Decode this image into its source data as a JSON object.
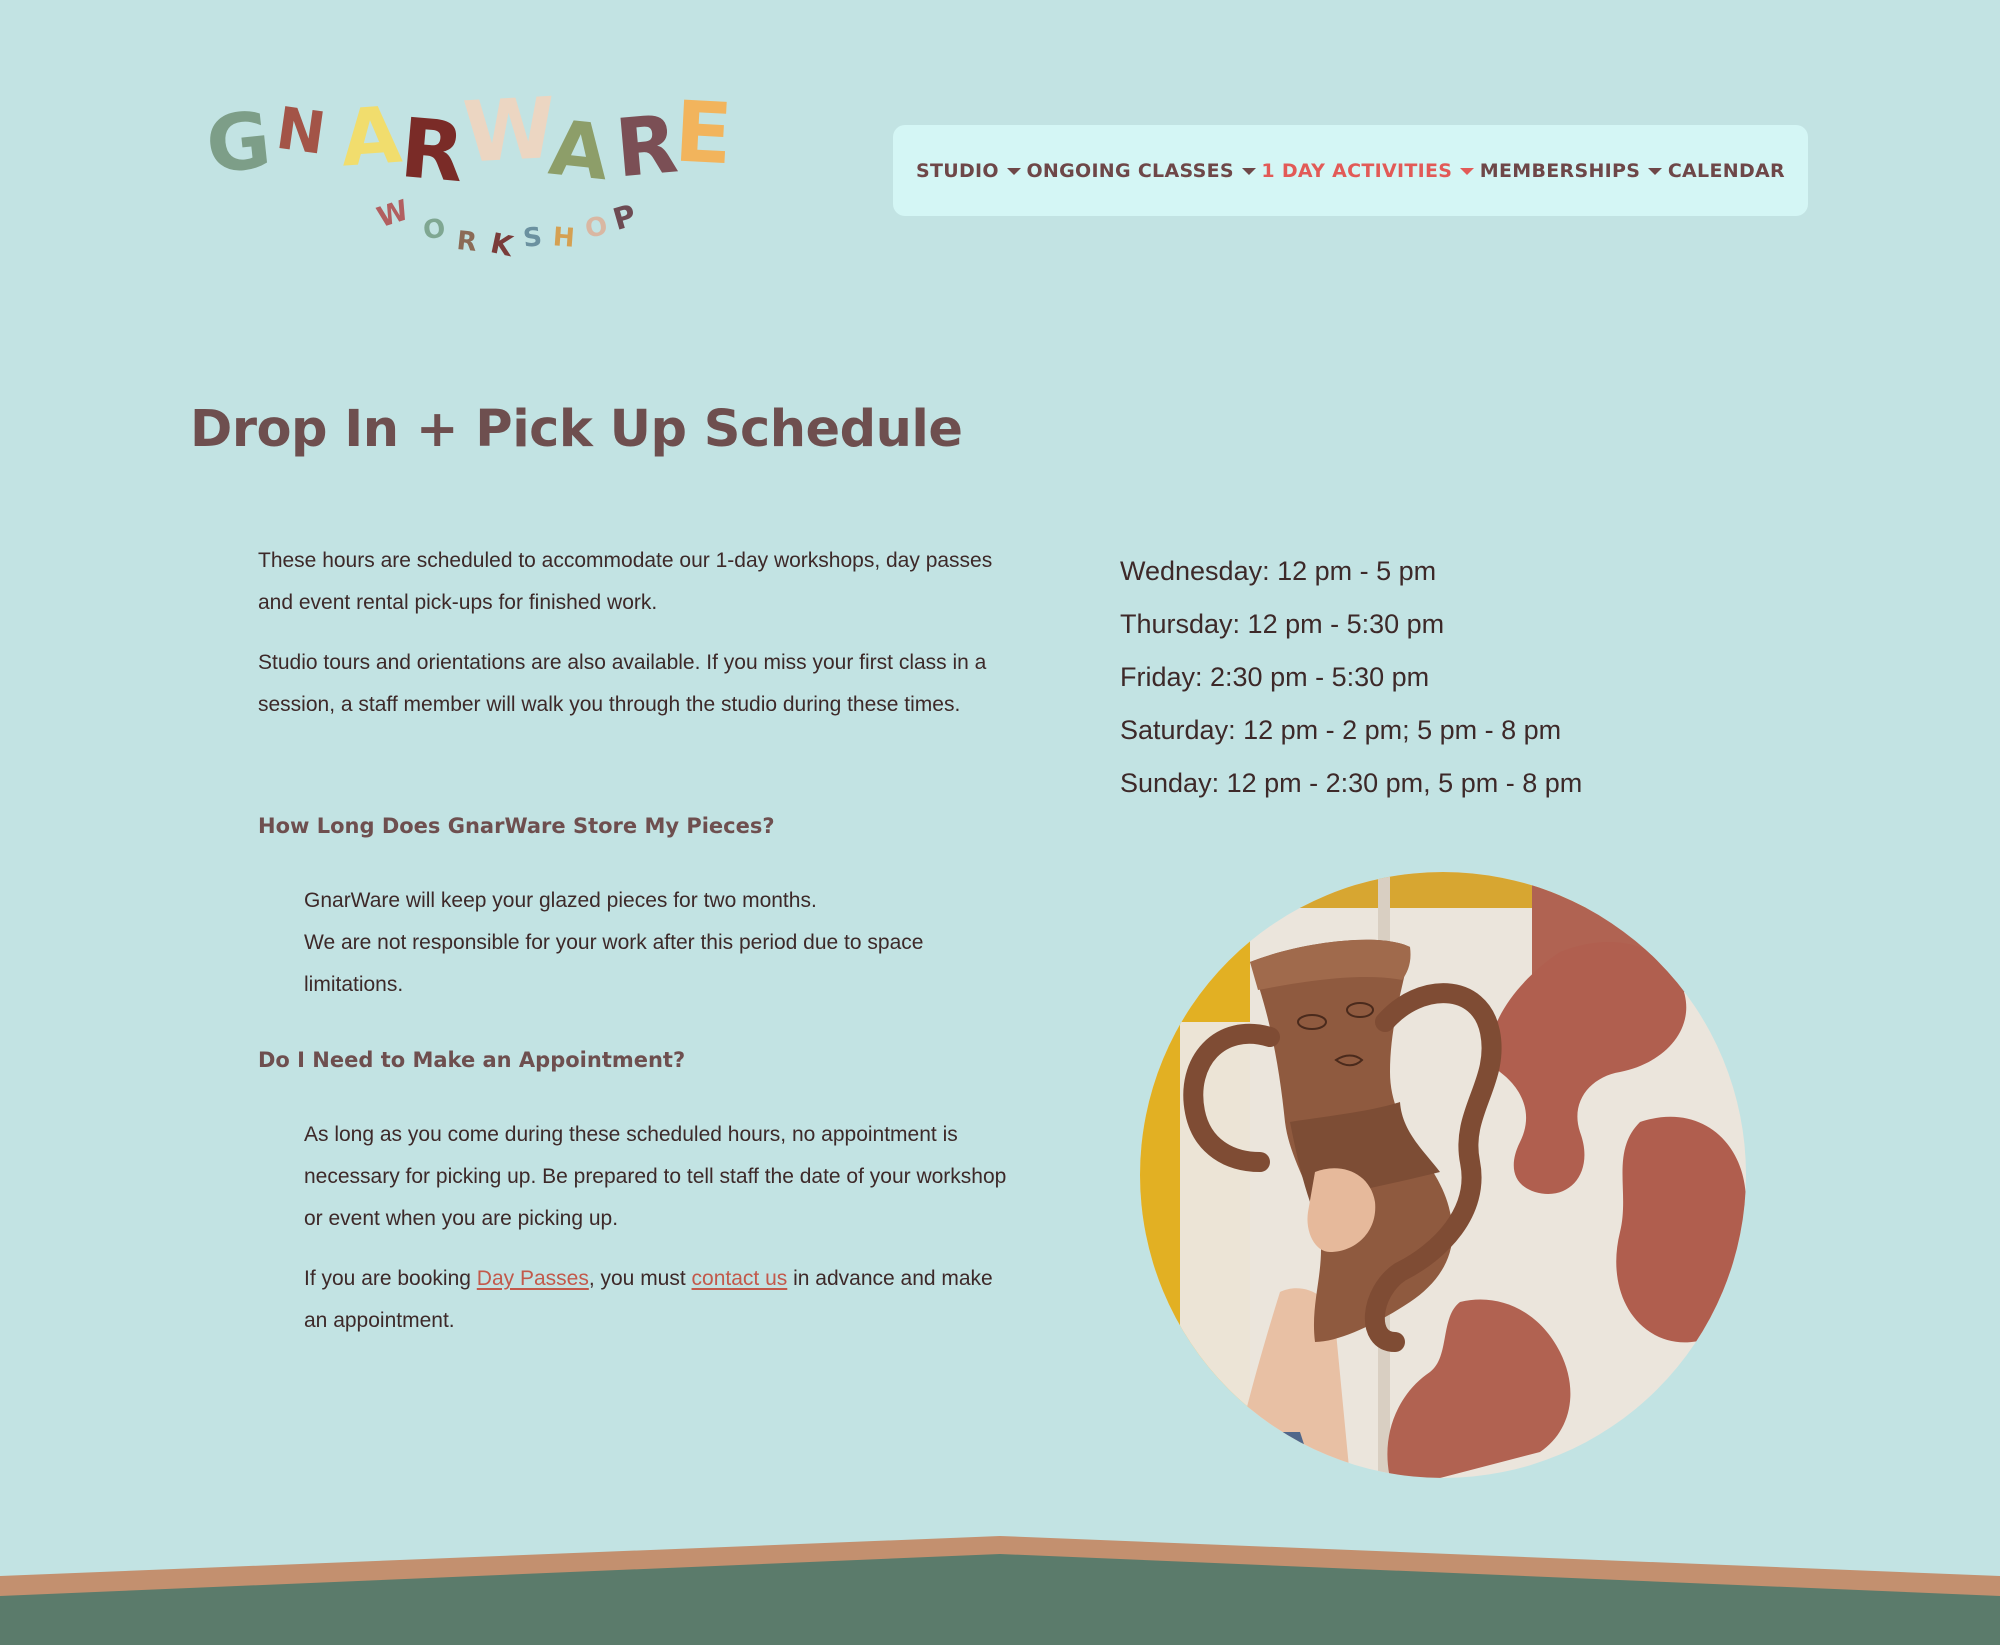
{
  "header": {
    "logo": {
      "wordmark": "GNARWARE",
      "subtitle": "WORKSHOP"
    },
    "nav": [
      {
        "label": "STUDIO",
        "has_dropdown": true,
        "active": false
      },
      {
        "label": "ONGOING CLASSES",
        "has_dropdown": true,
        "active": false
      },
      {
        "label": "1 DAY ACTIVITIES",
        "has_dropdown": true,
        "active": true
      },
      {
        "label": "MEMBERSHIPS",
        "has_dropdown": true,
        "active": false
      },
      {
        "label": "CALENDAR",
        "has_dropdown": false,
        "active": false
      }
    ]
  },
  "main": {
    "title": "Drop In + Pick Up Schedule",
    "intro": [
      "These hours are scheduled to accommodate our 1-day workshops, day passes and event rental pick-ups for finished work.",
      "Studio tours and orientations are also available. If you miss your first class in a session, a staff member will walk you through the studio during these times."
    ],
    "faq": [
      {
        "question": "How Long Does GnarWare Store My Pieces?",
        "answer_lines": [
          "GnarWare will keep your glazed pieces for two months.",
          "We are not responsible for your work after this period due to space limitations."
        ]
      },
      {
        "question": "Do I Need to Make an Appointment?",
        "answer": "As long as you come during these scheduled hours, no appointment is necessary for picking up. Be prepared to tell staff the date of your workshop or event when you are picking up.",
        "booking": {
          "prefix": "If you are booking ",
          "link1": "Day Passes",
          "middle": ", you must ",
          "link2": "contact us",
          "suffix": " in advance and make an appointment."
        }
      }
    ],
    "hours": [
      "Wednesday: 12 pm - 5 pm",
      "Thursday: 12 pm - 5:30 pm",
      "Friday: 2:30 pm - 5:30 pm",
      "Saturday: 12 pm - 2 pm; 5 pm - 8 pm",
      "Sunday: 12 pm - 2:30 pm, 5 pm - 8 pm"
    ]
  },
  "colors": {
    "background": "#c2e3e3",
    "nav_background": "#d4f6f5",
    "nav_text": "#6e4748",
    "nav_active": "#e25a57",
    "heading": "#6e4f4f",
    "body_text": "#3d2929",
    "link": "#c2594b",
    "footer_stripe": "#c3906f",
    "footer_green": "#5b7b6b"
  }
}
